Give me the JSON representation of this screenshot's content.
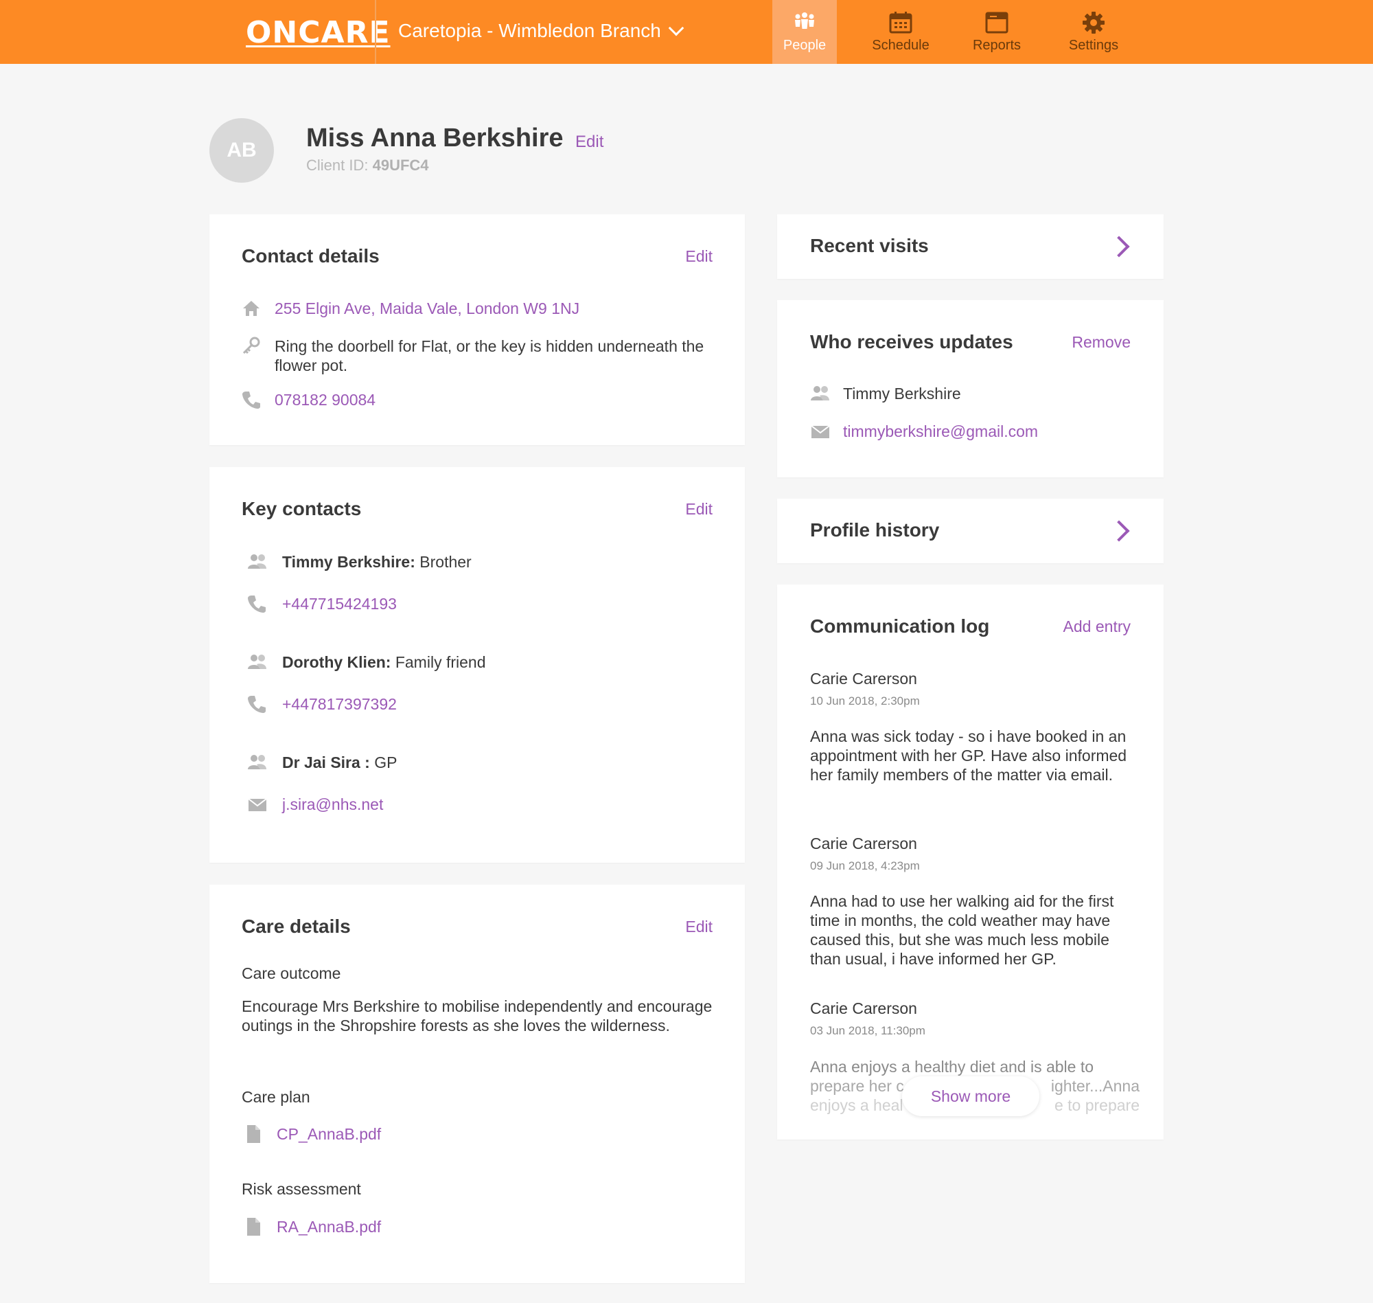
{
  "app": {
    "logo": "ONCARE",
    "branch": "Caretopia - Wimbledon Branch",
    "nav": [
      {
        "label": "People",
        "icon": "people-icon",
        "active": true
      },
      {
        "label": "Schedule",
        "icon": "calendar-icon"
      },
      {
        "label": "Reports",
        "icon": "folder-icon"
      },
      {
        "label": "Settings",
        "icon": "gear-icon"
      }
    ],
    "accent": "#fd8a24",
    "link_color": "#9b59b6"
  },
  "profile": {
    "initials": "AB",
    "name": "Miss Anna Berkshire",
    "edit_label": "Edit",
    "client_id_label": "Client ID:",
    "client_id": "49UFC4"
  },
  "contact": {
    "title": "Contact details",
    "edit_label": "Edit",
    "address": "255 Elgin Ave, Maida Vale, London W9 1NJ",
    "access_note": "Ring the doorbell for Flat, or the key is hidden underneath the flower pot.",
    "phone": "078182 90084"
  },
  "key_contacts": {
    "title": "Key contacts",
    "edit_label": "Edit",
    "items": [
      {
        "name": "Timmy Berkshire:",
        "relation": "Brother",
        "contact": "+447715424193",
        "contact_icon": "phone-icon"
      },
      {
        "name": "Dorothy Klien:",
        "relation": "Family friend",
        "contact": "+447817397392",
        "contact_icon": "phone-icon"
      },
      {
        "name": "Dr Jai Sira :",
        "relation": "GP",
        "contact": "j.sira@nhs.net",
        "contact_icon": "mail-icon"
      }
    ]
  },
  "care": {
    "title": "Care details",
    "edit_label": "Edit",
    "outcome_label": "Care outcome",
    "outcome_text": "Encourage Mrs Berkshire to mobilise independently and encourage outings in the Shropshire forests as she loves the wilderness.",
    "plan_label": "Care plan",
    "plan_file": "CP_AnnaB.pdf",
    "risk_label": "Risk assessment",
    "risk_file": "RA_AnnaB.pdf"
  },
  "recent_visits": {
    "title": "Recent visits"
  },
  "updates": {
    "title": "Who receives updates",
    "remove_label": "Remove",
    "name": "Timmy Berkshire",
    "email": "timmyberkshire@gmail.com"
  },
  "profile_history": {
    "title": "Profile history"
  },
  "comm_log": {
    "title": "Communication log",
    "add_label": "Add entry",
    "entries": [
      {
        "author": "Carie Carerson",
        "date": "10 Jun 2018, 2:30pm",
        "text": "Anna was sick today - so i have booked in an appointment with her GP. Have also informed her family members of the matter via email."
      },
      {
        "author": "Carie Carerson",
        "date": "09 Jun 2018, 4:23pm",
        "text": "Anna had to use her walking aid for the first time in months, the cold weather may have caused this, but she was much less mobile than usual, i have informed her GP."
      },
      {
        "author": "Carie Carerson",
        "date": "03 Jun 2018, 11:30pm",
        "text_line1": "Anna enjoys a healthy diet and is able to",
        "text_line2_a": "prepare her c",
        "text_line2_b": "ighter...Anna",
        "text_line3_a": "enjoys a heal",
        "text_line3_b": "e to prepare"
      }
    ],
    "show_more": "Show more"
  }
}
